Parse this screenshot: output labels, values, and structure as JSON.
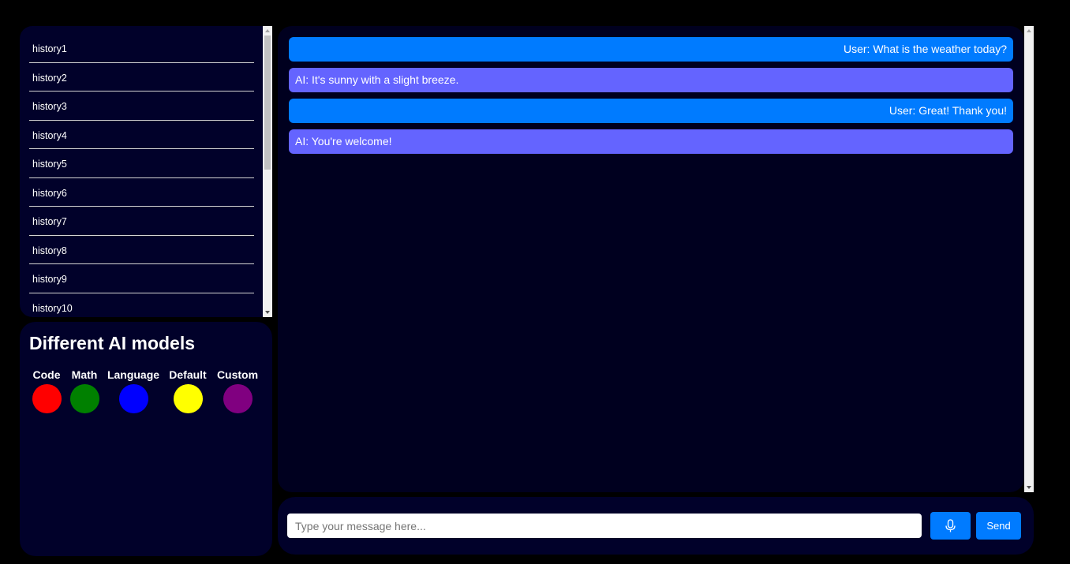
{
  "history": {
    "items": [
      "history1",
      "history2",
      "history3",
      "history4",
      "history5",
      "history6",
      "history7",
      "history8",
      "history9",
      "history10"
    ]
  },
  "models": {
    "title": "Different AI models",
    "items": [
      {
        "label": "Code",
        "color": "#ff0000"
      },
      {
        "label": "Math",
        "color": "#008000"
      },
      {
        "label": "Language",
        "color": "#0000ff"
      },
      {
        "label": "Default",
        "color": "#ffff00"
      },
      {
        "label": "Custom",
        "color": "#800080"
      }
    ]
  },
  "chat": {
    "messages": [
      {
        "role": "user",
        "text": "User: What is the weather today?",
        "color": "#007bff"
      },
      {
        "role": "ai",
        "text": "AI: It's sunny with a slight breeze.",
        "color": "#6464ff"
      },
      {
        "role": "user",
        "text": "User: Great! Thank you!",
        "color": "#007bff"
      },
      {
        "role": "ai",
        "text": "AI: You're welcome!",
        "color": "#6464ff"
      }
    ]
  },
  "input": {
    "placeholder": "Type your message here...",
    "value": "",
    "mic_icon": "microphone-icon",
    "send_label": "Send"
  },
  "colors": {
    "page_background": "#000000",
    "panel_background": "#01012a",
    "chat_background": "#00001f",
    "accent": "#007bff"
  }
}
